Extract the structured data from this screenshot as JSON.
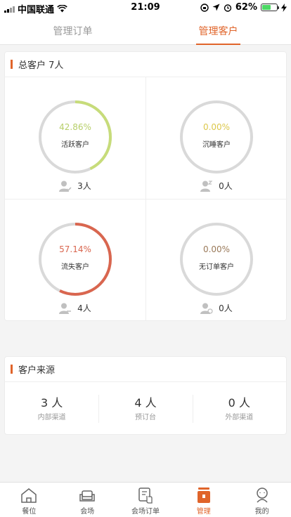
{
  "status_bar": {
    "carrier": "中国联通",
    "time": "21:09",
    "battery": "62%",
    "battery_level": 0.62
  },
  "tabs": [
    {
      "label": "管理订单",
      "active": false
    },
    {
      "label": "管理客户",
      "active": true
    }
  ],
  "customers": {
    "title": "总客户 7人",
    "cells": [
      {
        "percent": "42.86%",
        "label": "活跃客户",
        "count": "3人",
        "fraction": 0.4286,
        "color": "#c7dc7a",
        "text_color": "#b7cf6a"
      },
      {
        "percent": "0.00%",
        "label": "沉睡客户",
        "count": "0人",
        "fraction": 0,
        "color": "#e8d65a",
        "text_color": "#dcc84c"
      },
      {
        "percent": "57.14%",
        "label": "流失客户",
        "count": "4人",
        "fraction": 0.5714,
        "color": "#d9664f",
        "text_color": "#d9664f"
      },
      {
        "percent": "0.00%",
        "label": "无订单客户",
        "count": "0人",
        "fraction": 0,
        "color": "#9a7a5a",
        "text_color": "#9a7a5a"
      }
    ]
  },
  "sources": {
    "title": "客户来源",
    "items": [
      {
        "value": "3 人",
        "label": "内部渠道"
      },
      {
        "value": "4 人",
        "label": "预订台"
      },
      {
        "value": "0 人",
        "label": "外部渠道"
      }
    ]
  },
  "nav": [
    {
      "label": "餐位",
      "icon": "house-icon",
      "active": false
    },
    {
      "label": "会场",
      "icon": "sofa-icon",
      "active": false
    },
    {
      "label": "会场订单",
      "icon": "order-tap-icon",
      "active": false
    },
    {
      "label": "管理",
      "icon": "manage-icon",
      "active": true
    },
    {
      "label": "我的",
      "icon": "profile-icon",
      "active": false
    }
  ],
  "colors": {
    "accent": "#e0642a",
    "ring_track": "#d9d9d9"
  }
}
